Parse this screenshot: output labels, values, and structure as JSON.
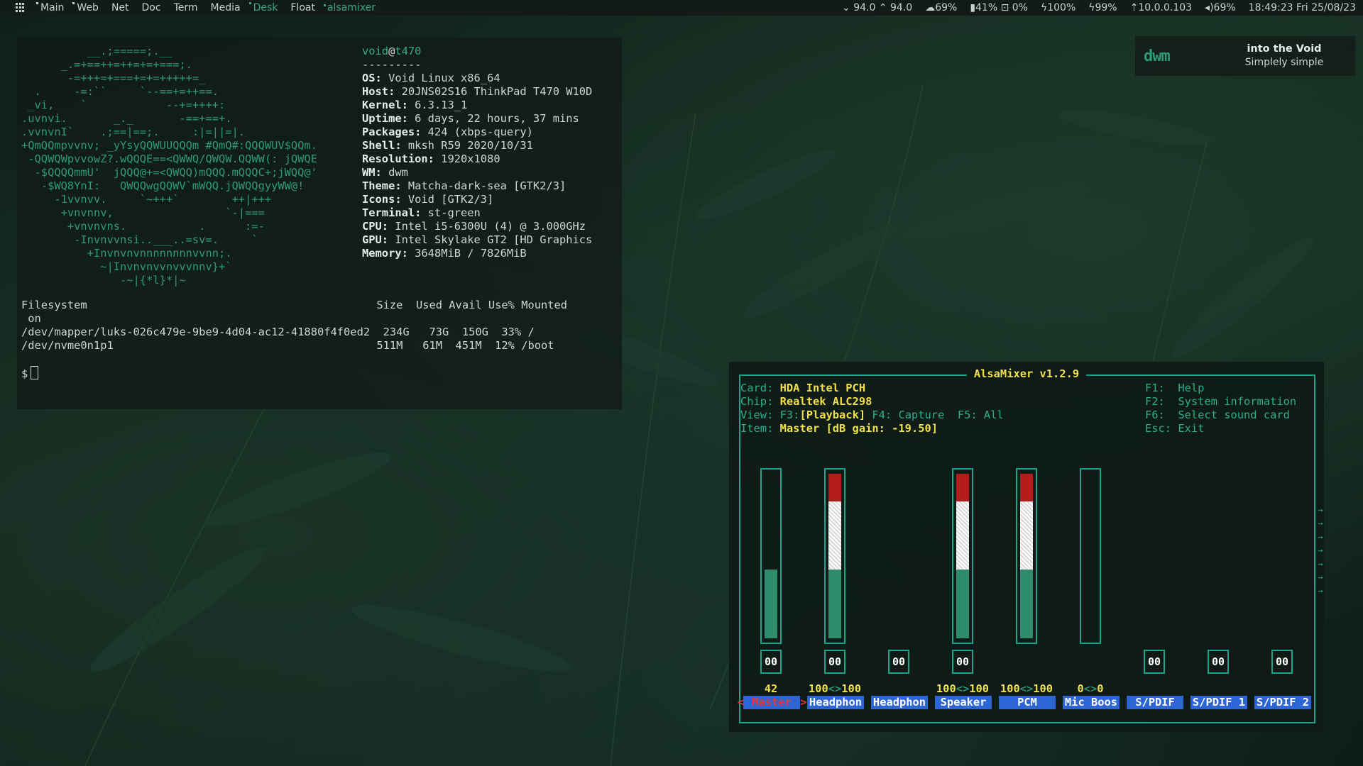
{
  "topbar": {
    "tags": [
      "Main",
      "Web",
      "Net",
      "Doc",
      "Term",
      "Media",
      "Desk",
      "Float"
    ],
    "window_title": "alsamixer",
    "status": [
      "⌄ 94.0 ⌃ 94.0",
      "☁69%",
      "▮41% ⊡ 0%",
      "ϟ100%",
      "ϟ99%",
      "⇡10.0.0.103",
      "◂)69%",
      "18:49:23 Fri 25/08/23"
    ]
  },
  "terminal": {
    "logo": "          __.;=====;.__\n      _.=+==++=++=+=+===;.\n       -=+++=+===+=+=+++++=_\n  .     -=:``     `--==+=++==.\n _vi,    `            --+=++++:\n.uvnvi.       _._       -==+==+.\n.vvnvnI`    .;==|==;.     :|=||=|.\n+QmQQmpvvnv; _yYsyQQWUUQQQm #QmQ#:QQQWUV$QQm.\n -QQWQWpvvowZ?.wQQQE==<QWWQ/QWQW.QQWW(: jQWQE\n  -$QQQQmmU'  jQQQ@+=<QWQQ)mQQQ.mQQQC+;jWQQ@'\n   -$WQ8YnI:   QWQQwgQQWV`mWQQ.jQWQQgyyWW@!\n     -1vvnvv.     `~+++`        ++|+++\n      +vnvnnv,                 `-|===\n       +vnvnvns.           .      :=-\n        -Invnvvnsi..___..=sv=.     `\n          +Invnvnvnnnnnnnnvvnn;.\n            ~|Invnvnvvnvvvnnv}+`\n               -~|{*l}*|~",
    "user": "void",
    "at": "@",
    "host": "t470",
    "separator": "---------",
    "info": [
      {
        "k": "OS:",
        "v": " Void Linux x86_64"
      },
      {
        "k": "Host:",
        "v": " 20JNS02S16 ThinkPad T470 W10D"
      },
      {
        "k": "Kernel:",
        "v": " 6.3.13_1"
      },
      {
        "k": "Uptime:",
        "v": " 6 days, 22 hours, 37 mins"
      },
      {
        "k": "Packages:",
        "v": " 424 (xbps-query)"
      },
      {
        "k": "Shell:",
        "v": " mksh R59 2020/10/31"
      },
      {
        "k": "Resolution:",
        "v": " 1920x1080"
      },
      {
        "k": "WM:",
        "v": " dwm"
      },
      {
        "k": "Theme:",
        "v": " Matcha-dark-sea [GTK2/3]"
      },
      {
        "k": "Icons:",
        "v": " Void [GTK2/3]"
      },
      {
        "k": "Terminal:",
        "v": " st-green"
      },
      {
        "k": "CPU:",
        "v": " Intel i5-6300U (4) @ 3.000GHz"
      },
      {
        "k": "GPU:",
        "v": " Intel Skylake GT2 [HD Graphics"
      },
      {
        "k": "Memory:",
        "v": " 3648MiB / 7826MiB"
      }
    ],
    "df": "Filesystem                                            Size  Used Avail Use% Mounted\n on\n/dev/mapper/luks-026c479e-9be9-4d04-ac12-41880f4f0ed2  234G   73G  150G  33% /\n/dev/nvme0n1p1                                        511M   61M  451M  12% /boot",
    "prompt": "$"
  },
  "notification": {
    "logo": "dwm",
    "title": "into the Void",
    "body": "Simplely simple"
  },
  "alsamixer": {
    "title": "AlsaMixer v1.2.9",
    "card_label": "Card:",
    "card": "HDA Intel PCH",
    "chip_label": "Chip:",
    "chip": "Realtek ALC298",
    "view_label": "View:",
    "view_f3": "F3:",
    "view_playback": "[Playback]",
    "view_rest": " F4: Capture  F5: All",
    "item_label": "Item:",
    "item": "Master [dB gain: -19.50]",
    "help": [
      {
        "k": "F1:",
        "d": "Help"
      },
      {
        "k": "F2:",
        "d": "System information"
      },
      {
        "k": "F6:",
        "d": "Select sound card"
      },
      {
        "k": "Esc:",
        "d": "Exit"
      }
    ],
    "channels": [
      {
        "name": "Master",
        "value": "42",
        "mute": "00",
        "bar": true,
        "level": 0.42,
        "selected": true
      },
      {
        "name": "Headphon",
        "value": "100<>100",
        "mute": "00",
        "bar": true,
        "level": 1.0
      },
      {
        "name": "Headphon",
        "value": "",
        "mute": "00",
        "bar": false
      },
      {
        "name": "Speaker",
        "value": "100<>100",
        "mute": "00",
        "bar": true,
        "level": 1.0
      },
      {
        "name": "PCM",
        "value": "100<>100",
        "mute": "",
        "bar": true,
        "level": 1.0
      },
      {
        "name": "Mic Boos",
        "value": "0<>0",
        "mute": "",
        "bar": true,
        "level": 0.0
      },
      {
        "name": "S/PDIF",
        "value": "",
        "mute": "00",
        "bar": false
      },
      {
        "name": "S/PDIF 1",
        "value": "",
        "mute": "00",
        "bar": false
      },
      {
        "name": "S/PDIF 2",
        "value": "",
        "mute": "00",
        "bar": false
      }
    ]
  }
}
